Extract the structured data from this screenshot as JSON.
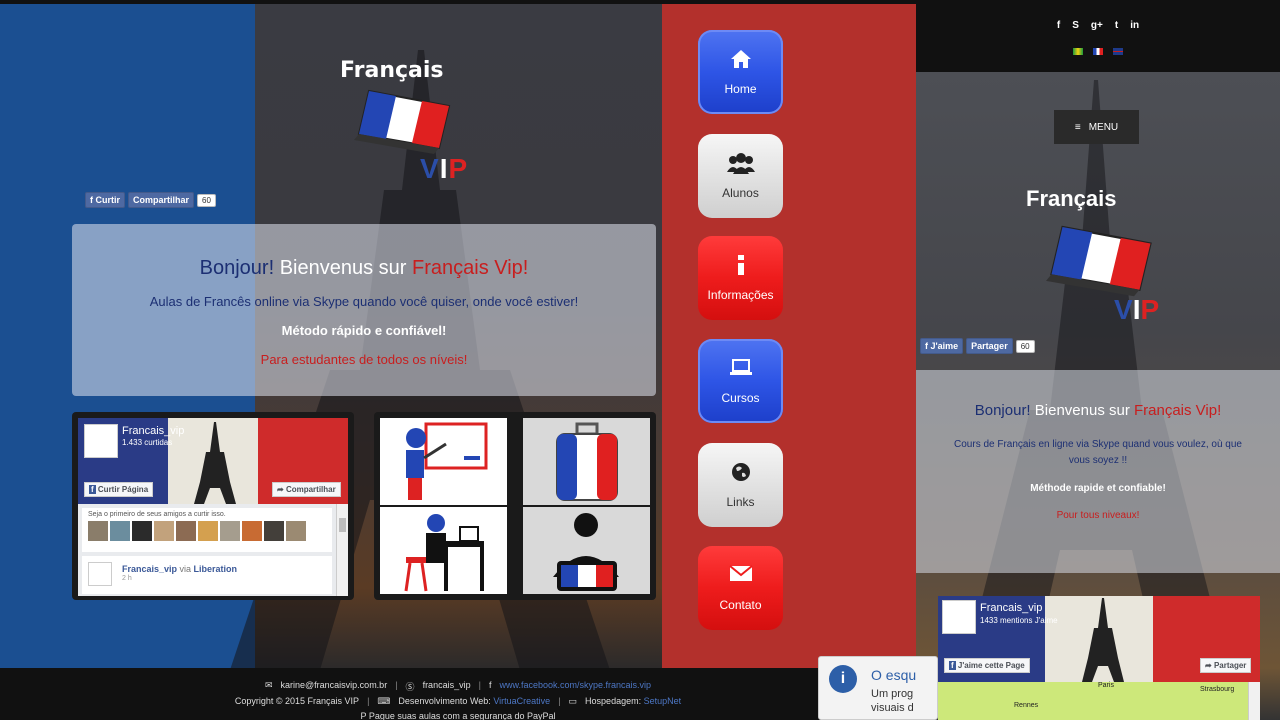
{
  "left_site": {
    "logo": {
      "word": "Français",
      "vip": [
        "V",
        "I",
        "P"
      ]
    },
    "fb_like": {
      "curtir": "Curtir",
      "compartilhar": "Compartilhar",
      "count": "60"
    },
    "welcome": {
      "title_a": "Bonjour!",
      "title_b": " Bienvenus sur ",
      "title_c": "Français Vip!",
      "line1": "Aulas de Francês online via Skype quando você quiser, onde você estiver!",
      "line2": "Método rápido e confiável!",
      "line3": "Para estudantes de todos os níveis!"
    },
    "fb_widget": {
      "page_name": "Francais_vip",
      "likes": "1.433 curtidas",
      "like_page": "Curtir Página",
      "share": "Compartilhar",
      "friends_text": "Seja o primeiro de seus amigos a curtir isso.",
      "post_author": "Francais_vip",
      "post_via": " via ",
      "post_source": "Liberation",
      "post_time": "2 h"
    },
    "nav": [
      {
        "label": "Home",
        "icon": "home-icon"
      },
      {
        "label": "Alunos",
        "icon": "users-icon"
      },
      {
        "label": "Informações",
        "icon": "info-icon"
      },
      {
        "label": "Cursos",
        "icon": "laptop-icon"
      },
      {
        "label": "Links",
        "icon": "globe-icon"
      },
      {
        "label": "Contato",
        "icon": "envelope-icon"
      }
    ],
    "footer": {
      "email": "karine@francaisvip.com.br",
      "skype": "francais_vip",
      "facebook": "www.facebook.com/skype.francais.vip",
      "copyright": "Copyright © 2015 Français VIP",
      "dev_label": "Desenvolvimento Web:",
      "dev_name": "VirtuaCreative",
      "host_label": "Hospedagem:",
      "host_name": "SetupNet",
      "paypal": "Pague suas aulas com a segurança do PayPal"
    }
  },
  "right_site": {
    "social_icons": [
      "facebook-icon",
      "skype-icon",
      "google-plus-icon",
      "twitter-icon",
      "linkedin-icon"
    ],
    "social_glyphs": [
      "f",
      "S",
      "g+",
      "t",
      "in"
    ],
    "menu_label": "MENU",
    "fb_like": {
      "jaime": "J'aime",
      "partager": "Partager",
      "count": "60"
    },
    "welcome": {
      "title_a": "Bonjour!",
      "title_b": " Bienvenus sur ",
      "title_c": "Français Vip!",
      "line1": "Cours de Français en ligne via Skype quand vous voulez, où que vous soyez !!",
      "line2": "Méthode rapide et confiable!",
      "line3": "Pour tous niveaux!"
    },
    "fb_widget": {
      "page_name": "Francais_vip",
      "likes": "1433 mentions J'aime",
      "like_page": "J'aime cette Page",
      "share": "Partager",
      "map_labels": [
        "Paris",
        "Strasbourg",
        "Rennes"
      ]
    }
  },
  "notification": {
    "title": "O esqu",
    "text": "Um prog visuais d"
  },
  "colors": {
    "flag_blue": "#1b4f91",
    "flag_red": "#b3302c",
    "nav_blue": "#2e55e6",
    "nav_red": "#ee1c1c",
    "fb_blue": "#4e69a2"
  }
}
